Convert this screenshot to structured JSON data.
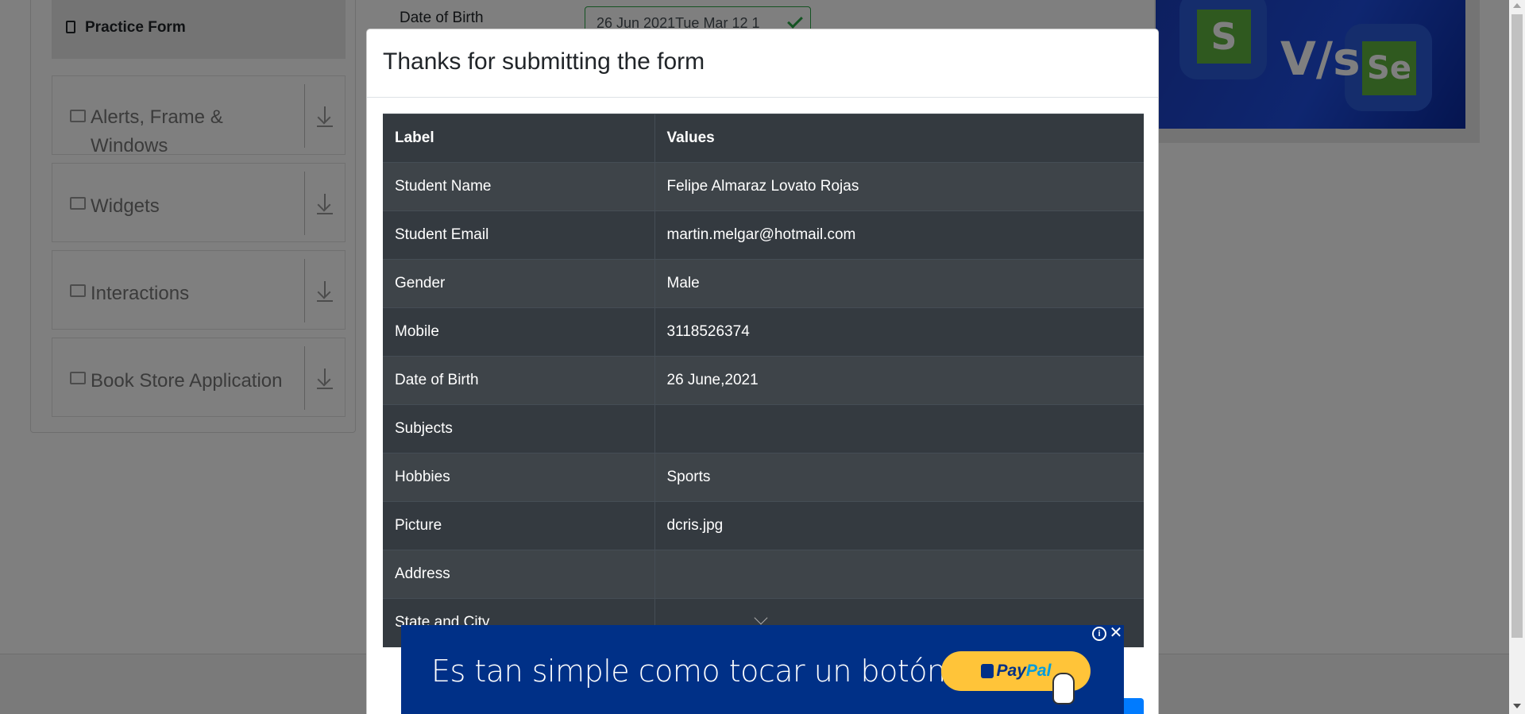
{
  "sidebar": {
    "active_item": "Practice Form",
    "groups": [
      {
        "label": "Alerts, Frame & Windows",
        "icon": "window-icon"
      },
      {
        "label": "Widgets",
        "icon": "widgets-icon"
      },
      {
        "label": "Interactions",
        "icon": "interactions-icon"
      },
      {
        "label": "Book Store Application",
        "icon": "book-icon"
      }
    ]
  },
  "form": {
    "dob_label": "Date of Birth",
    "dob_value": "26 Jun 2021Tue Mar 12 1"
  },
  "banner": {
    "left_logo_letter": "S",
    "vs_text": "V/s",
    "right_logo_text": "Se"
  },
  "modal": {
    "title": "Thanks for submitting the form",
    "table": {
      "headers": [
        "Label",
        "Values"
      ],
      "rows": [
        {
          "label": "Student Name",
          "value": "Felipe Almaraz Lovato Rojas"
        },
        {
          "label": "Student Email",
          "value": "martin.melgar@hotmail.com"
        },
        {
          "label": "Gender",
          "value": "Male"
        },
        {
          "label": "Mobile",
          "value": "3118526374"
        },
        {
          "label": "Date of Birth",
          "value": "26 June,2021"
        },
        {
          "label": "Subjects",
          "value": ""
        },
        {
          "label": "Hobbies",
          "value": "Sports"
        },
        {
          "label": "Picture",
          "value": "dcris.jpg"
        },
        {
          "label": "Address",
          "value": ""
        },
        {
          "label": "State and City",
          "value": ""
        }
      ]
    }
  },
  "ad": {
    "text": "Es tan simple como tocar un botón.",
    "button_pay": "Pay",
    "button_pal": "Pal",
    "info": "i",
    "close": "✕"
  },
  "colors": {
    "overlay": "#000000",
    "table_bg": "#343a40",
    "ad_bg": "#003087",
    "paypal_yellow": "#ffc439",
    "success": "#28a745"
  }
}
